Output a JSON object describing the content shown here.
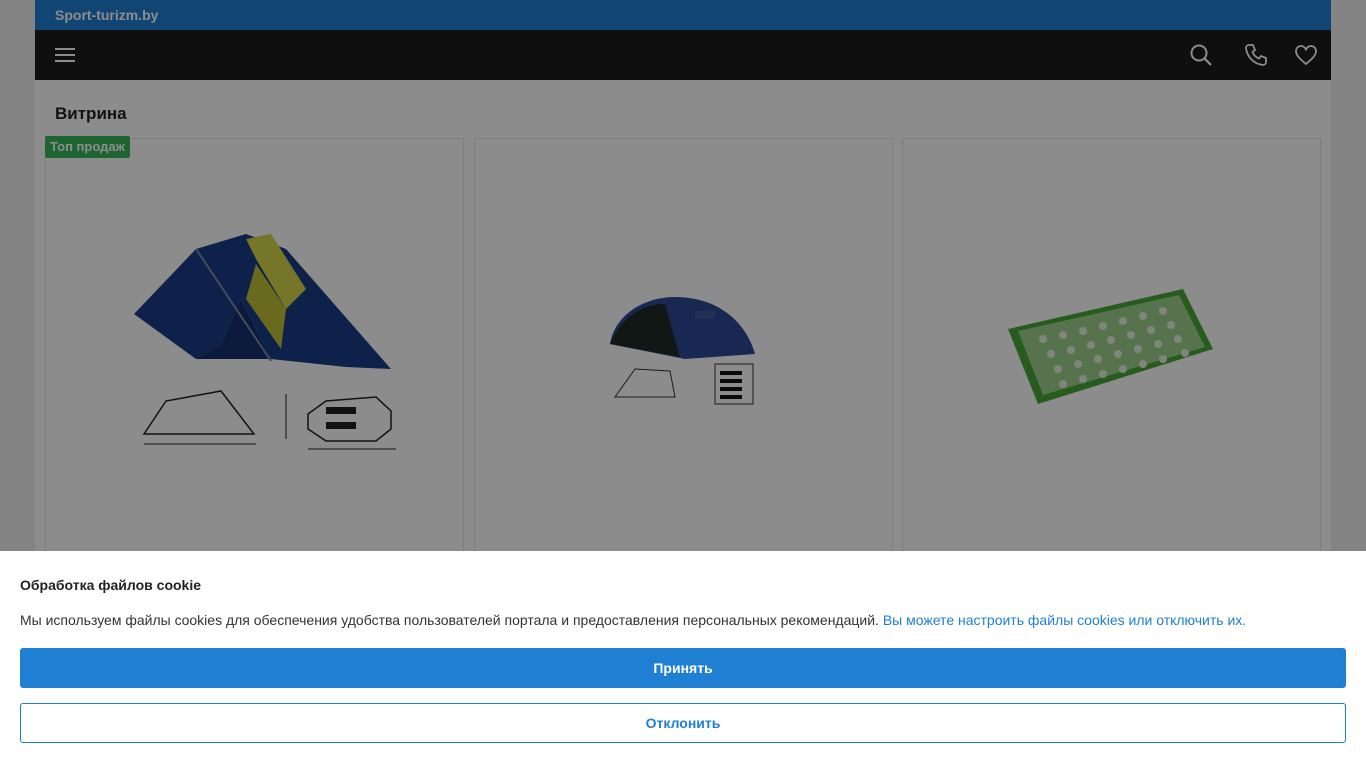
{
  "header": {
    "site_name": "Sport-turizm.by",
    "menu_icon": "hamburger-menu-icon",
    "search_icon": "search-icon",
    "phone_icon": "phone-icon",
    "favorites_icon": "heart-icon",
    "accent_color": "#1f7fd3"
  },
  "showcase": {
    "title": "Витрина",
    "badge": "Топ продаж",
    "products": [
      {
        "image": "tent-two-person-blue-yellow"
      },
      {
        "image": "tent-dome-blue-dark"
      },
      {
        "image": "acupressure-mat-green"
      }
    ]
  },
  "cookie_banner": {
    "title": "Обработка файлов cookie",
    "text": "Мы используем файлы cookies для обеспечения удобства пользователей портала и предоставления персональных рекомендаций.",
    "link": "Вы можете настроить файлы cookies или отключить их.",
    "accept": "Принять",
    "decline": "Отклонить"
  }
}
